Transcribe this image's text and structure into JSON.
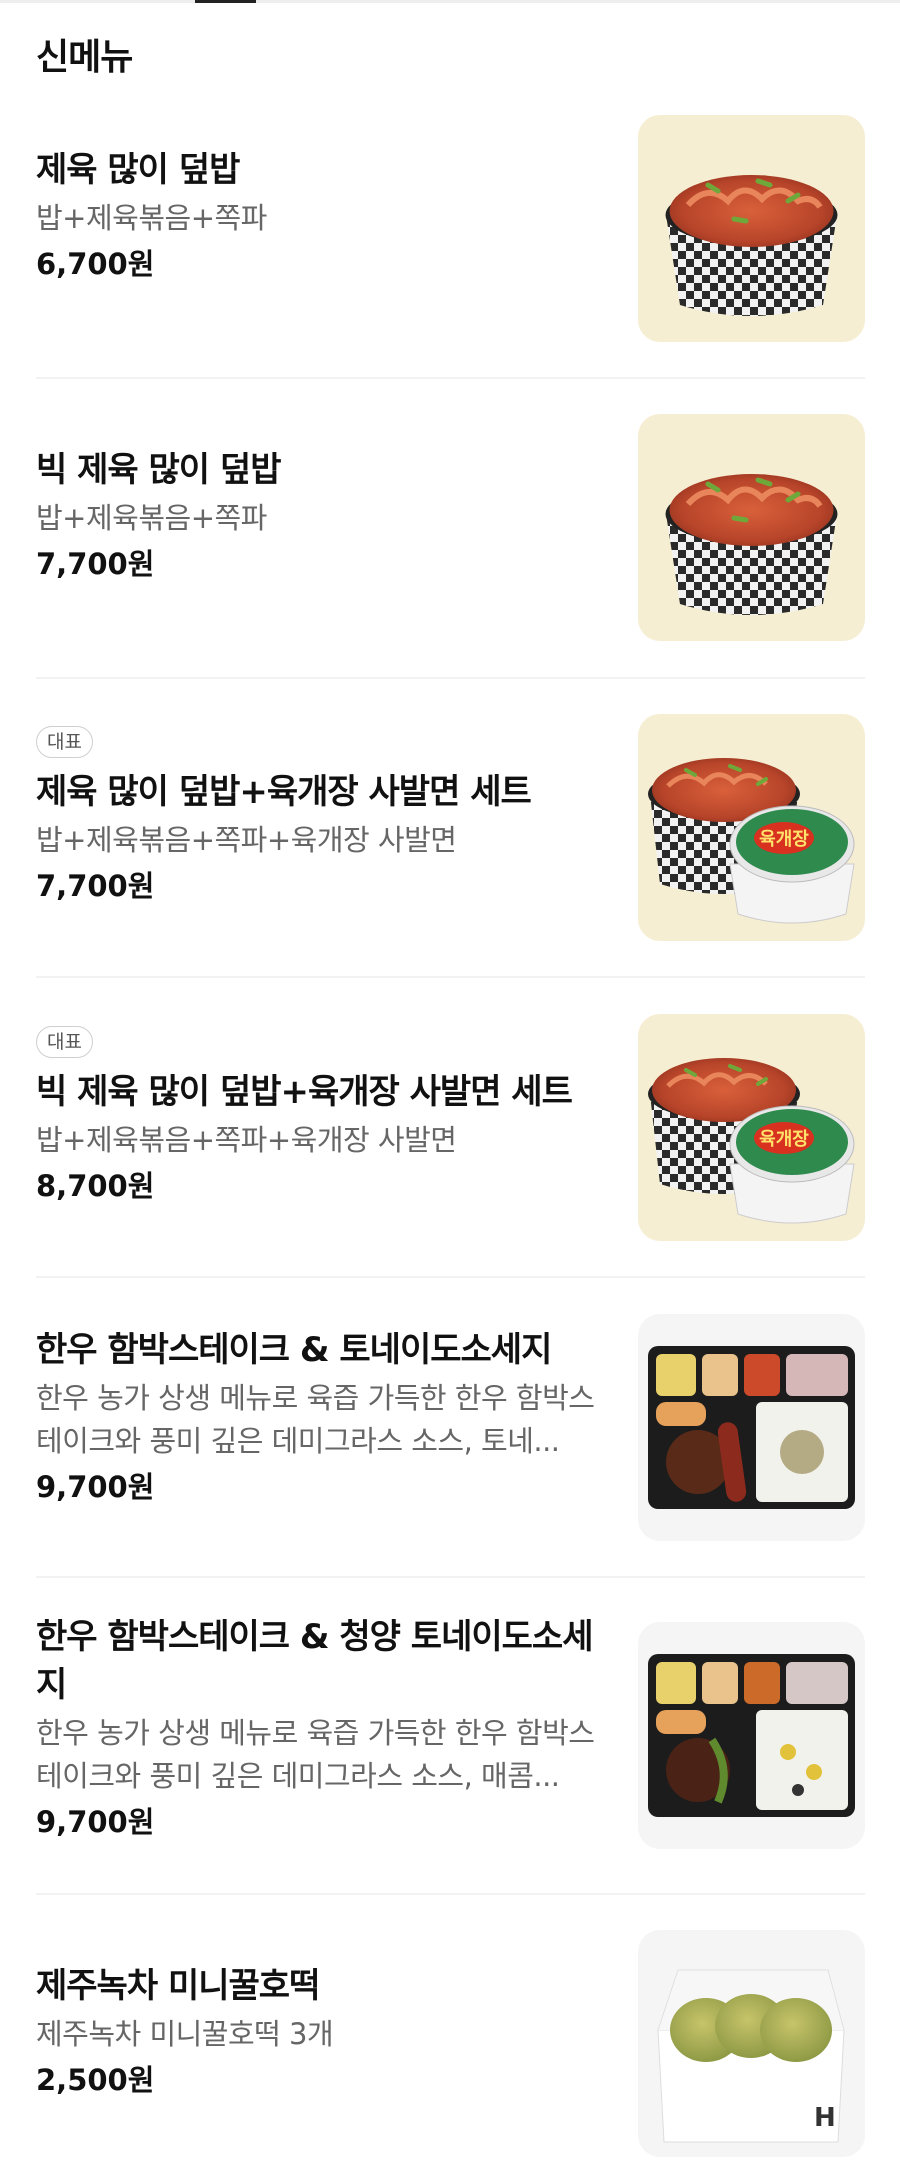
{
  "section_title": "신메뉴",
  "items": [
    {
      "badge": "",
      "name": "제육 많이 덮밥",
      "desc": "밥+제육볶음+쪽파",
      "price": "6,700원",
      "image": "pork-rice-bowl-icon",
      "bg": "#f6eed3"
    },
    {
      "badge": "",
      "name": "빅 제육 많이 덮밥",
      "desc": "밥+제육볶음+쪽파",
      "price": "7,700원",
      "image": "pork-rice-bowl-icon",
      "bg": "#f6eed3"
    },
    {
      "badge": "대표",
      "name": "제육 많이 덮밥+육개장 사발면 세트",
      "desc": "밥+제육볶음+쪽파+육개장 사발면",
      "price": "7,700원",
      "image": "rice-bowl-noodle-set-icon",
      "bg": "#f6eed3"
    },
    {
      "badge": "대표",
      "name": "빅 제육 많이 덮밥+육개장 사발면 세트",
      "desc": "밥+제육볶음+쪽파+육개장 사발면",
      "price": "8,700원",
      "image": "rice-bowl-noodle-set-icon",
      "bg": "#f6eed3"
    },
    {
      "badge": "",
      "name": "한우 함박스테이크 & 토네이도소세지",
      "desc": "한우 농가 상생 메뉴로 육즙 가득한 한우 함박스테이크와 풍미 깊은 데미그라스 소스, 토네...",
      "price": "9,700원",
      "image": "bento-box-icon",
      "bg": "#f5f5f5"
    },
    {
      "badge": "",
      "name": "한우 함박스테이크 & 청양 토네이도소세지",
      "desc": "한우 농가 상생 메뉴로 육즙 가득한 한우 함박스테이크와 풍미 깊은 데미그라스 소스, 매콤...",
      "price": "9,700원",
      "image": "bento-box-icon",
      "bg": "#f5f5f5"
    },
    {
      "badge": "",
      "name": "제주녹차 미니꿀호떡",
      "desc": "제주녹차 미니꿀호떡 3개",
      "price": "2,500원",
      "image": "hotteok-pack-icon",
      "bg": "#f5f5f5"
    }
  ],
  "labels": {
    "noodle_cup": "육개장"
  }
}
